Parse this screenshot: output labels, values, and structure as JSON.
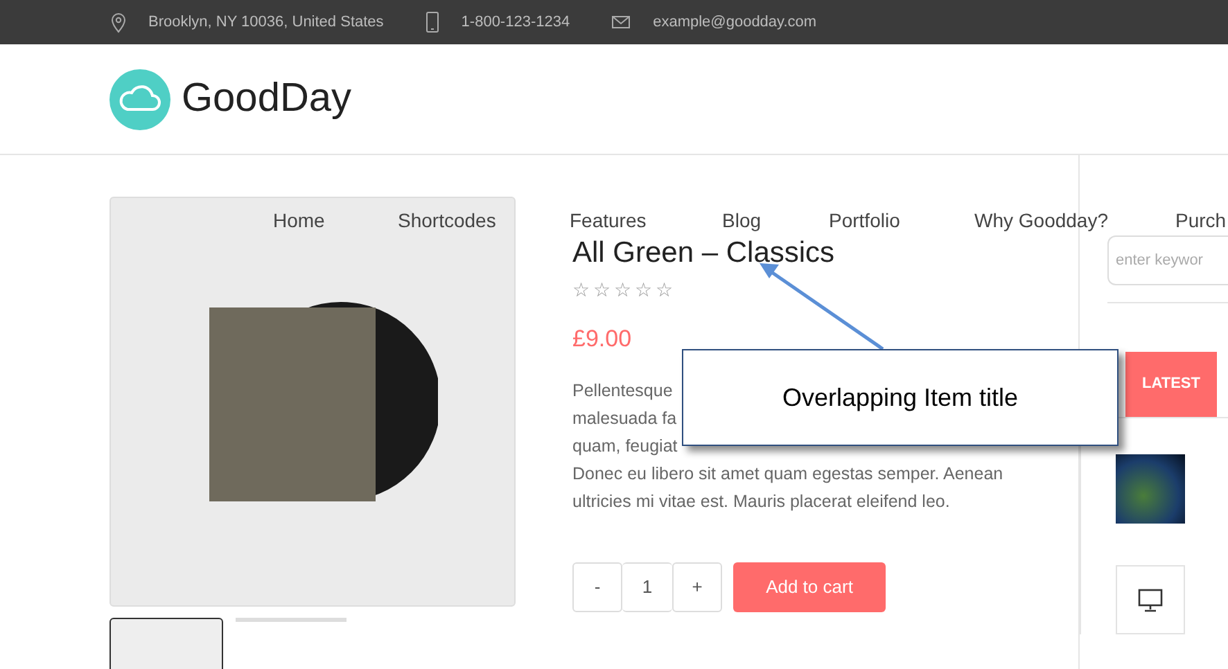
{
  "topbar": [
    {
      "kind": "pin",
      "text": "Brooklyn, NY 10036, United States"
    },
    {
      "kind": "phone",
      "text": "1-800-123-1234"
    },
    {
      "kind": "mail",
      "text": "example@goodday.com"
    }
  ],
  "logo": {
    "text": "GoodDay"
  },
  "nav": [
    "Home",
    "Shortcodes",
    "Features",
    "Blog",
    "Portfolio",
    "Why Goodday?",
    "Purch"
  ],
  "product": {
    "title": "All Green – Classics",
    "stars": 0,
    "price": "£9.00",
    "description": [
      "Pellentesque",
      "malesuada fa",
      "quam, feugiat",
      "Donec eu libero sit amet quam egestas semper. Aenean",
      "ultricies mi vitae est. Mauris placerat eleifend leo."
    ],
    "quantity": {
      "minus": "-",
      "value": "1",
      "plus": "+"
    },
    "add_button": "Add to cart"
  },
  "sidebar": {
    "search": {
      "placeholder": "enter keywor"
    },
    "tabs": [
      {
        "label": "LATEST",
        "selected": true
      }
    ]
  },
  "callout": {
    "text": "Overlapping Item title"
  }
}
